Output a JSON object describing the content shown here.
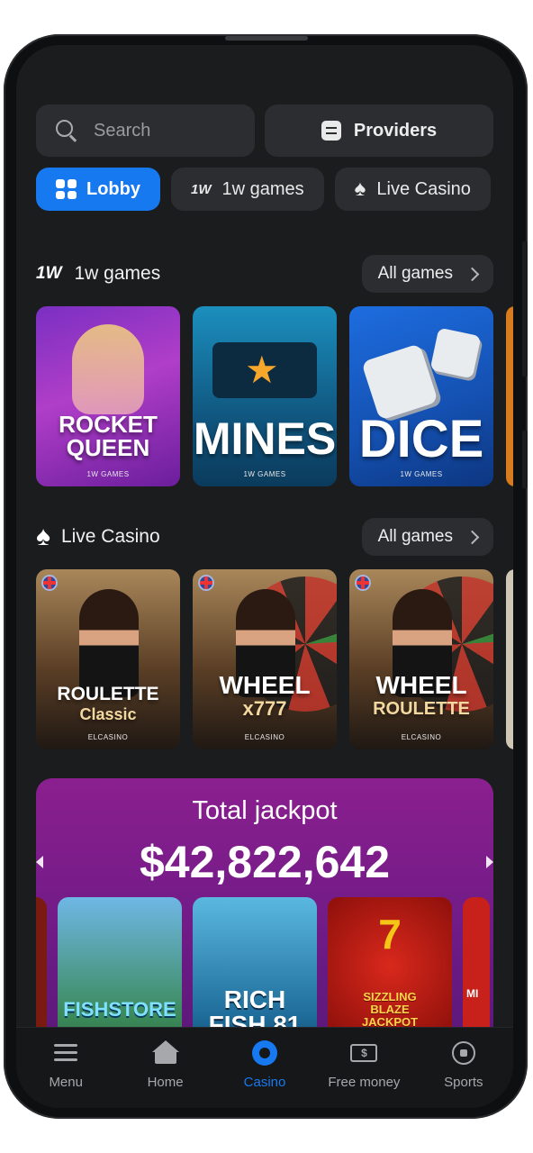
{
  "search": {
    "placeholder": "Search"
  },
  "providers_label": "Providers",
  "tabs": [
    {
      "label": "Lobby",
      "icon": "grid-icon",
      "active": true
    },
    {
      "label": "1w games",
      "icon": "1w-logo-icon",
      "badge": "1W"
    },
    {
      "label": "Live Casino",
      "icon": "spade-icon"
    }
  ],
  "sections": {
    "onew": {
      "logo": "1W",
      "title": "1w games",
      "all_label": "All games",
      "cards": [
        {
          "title_line1": "ROCKET",
          "title_line2": "QUEEN",
          "provider": "1W GAMES"
        },
        {
          "title_line1": "MINES",
          "provider": "1W GAMES"
        },
        {
          "title_line1": "DICE",
          "provider": "1W GAMES"
        }
      ]
    },
    "live": {
      "title": "Live Casino",
      "all_label": "All games",
      "cards": [
        {
          "title_line1": "ROULETTE",
          "title_line2": "Classic",
          "provider": "ELCASINO"
        },
        {
          "title_line1": "WHEEL",
          "title_line2": "x777",
          "provider": "ELCASINO"
        },
        {
          "title_line1": "WHEEL",
          "title_line2": "ROULETTE",
          "provider": "ELCASINO"
        }
      ]
    }
  },
  "jackpot": {
    "title": "Total jackpot",
    "amount": "$42,822,642",
    "cards": [
      {
        "title_line1": "FISHSTORE"
      },
      {
        "title_line1": "RICH",
        "title_line2": "FISH 81"
      },
      {
        "title_line1": "SIZZLING",
        "title_line2": "BLAZE",
        "title_line3": "JACKPOT"
      },
      {
        "title_line1": "MI"
      }
    ]
  },
  "nav": [
    {
      "label": "Menu",
      "icon": "menu-icon"
    },
    {
      "label": "Home",
      "icon": "home-icon"
    },
    {
      "label": "Casino",
      "icon": "casino-icon",
      "active": true
    },
    {
      "label": "Free money",
      "icon": "money-icon"
    },
    {
      "label": "Sports",
      "icon": "football-icon"
    }
  ],
  "colors": {
    "accent": "#1679f0",
    "background": "#1b1c1e",
    "surface": "#2c2d30",
    "jackpot": "#8b1f8f"
  }
}
